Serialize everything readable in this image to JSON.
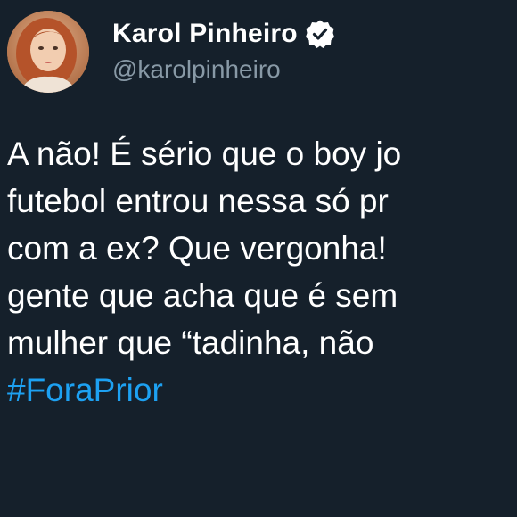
{
  "user": {
    "display_name": "Karol Pinheiro",
    "handle": "@karolpinheiro",
    "verified": true,
    "avatar_icon": "profile-photo"
  },
  "tweet": {
    "lines": [
      "A não! É sério que o boy jo",
      "futebol entrou nessa só pr",
      "com a ex? Que vergonha!",
      "gente que acha que é sem",
      "mulher que “tadinha, não"
    ],
    "hashtag": "#ForaPrior"
  },
  "colors": {
    "background": "#15202b",
    "text": "#ffffff",
    "secondary_text": "#8899a6",
    "link": "#1da1f2"
  }
}
